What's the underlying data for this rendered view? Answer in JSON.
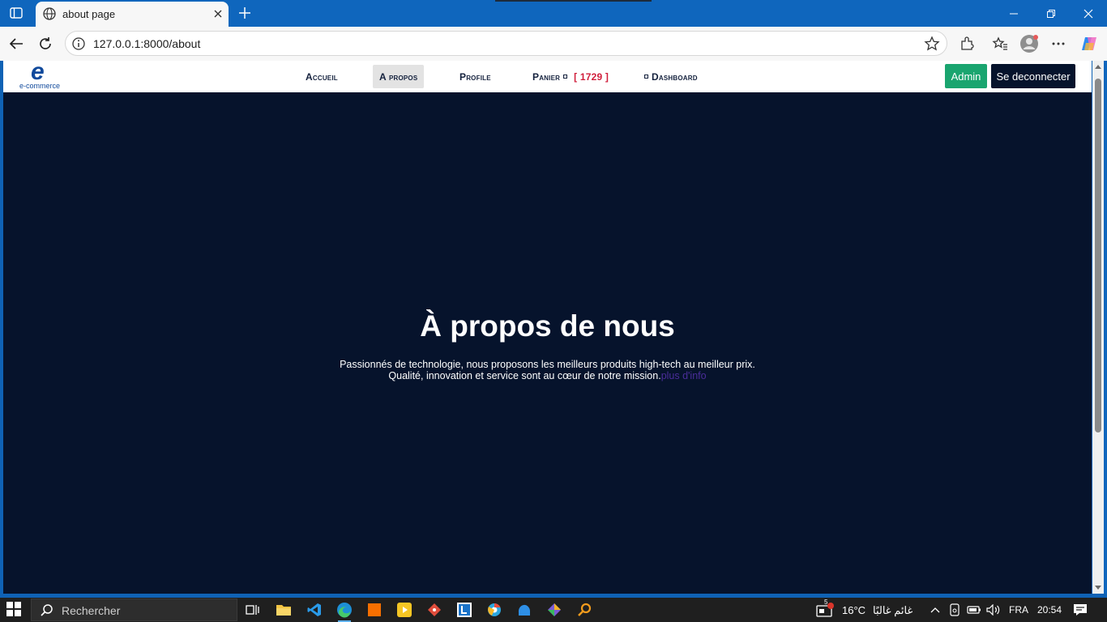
{
  "browser": {
    "tab_title": "about page",
    "url": "127.0.0.1:8000/about"
  },
  "site": {
    "logo_caption": "e-commerce",
    "nav": {
      "home": "Accueil",
      "about": "A propos",
      "profile": "Profile",
      "cart": "Panier",
      "cart_count": "[ 1729 ]",
      "dashboard": "Dashboard"
    },
    "admin_button": "Admin",
    "logout_button": "Se deconnecter"
  },
  "about": {
    "title": "À propos de nous",
    "line1": "Passionnés de technologie, nous proposons les meilleurs produits high-tech au meilleur prix.",
    "line2": "Qualité, innovation et service sont au cœur de notre mission.",
    "more_link": "plus d'info"
  },
  "taskbar": {
    "search_placeholder": "Rechercher",
    "weather_temp": "16°C",
    "weather_desc": "غائم غالبًا",
    "notification_badge": "5",
    "language": "FRA",
    "time": "20:54"
  },
  "colors": {
    "page_bg": "#06132c",
    "admin_green": "#1aa56f",
    "cart_count_red": "#d01f3c",
    "link_purple": "#4a2d9a",
    "browser_blue": "#0f66bd"
  }
}
